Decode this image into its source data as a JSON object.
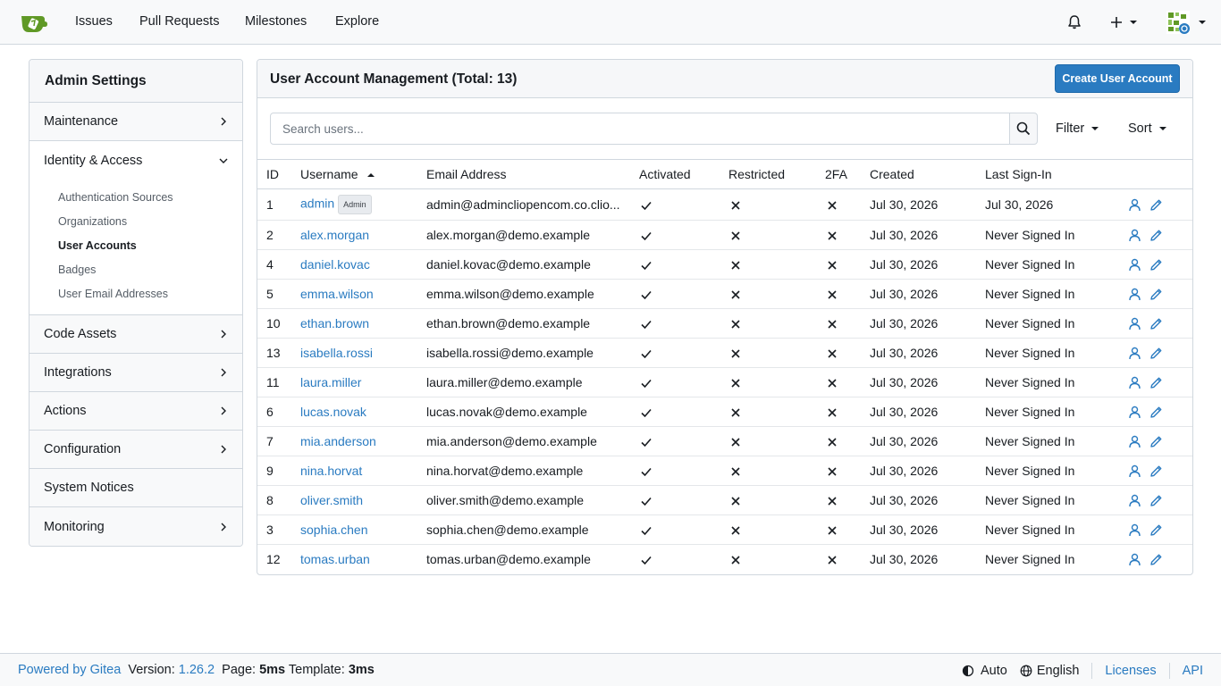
{
  "nav": {
    "links": [
      "Issues",
      "Pull Requests",
      "Milestones",
      "Explore"
    ],
    "icons": {
      "logo": "gitea-logo",
      "notifications": "bell-icon",
      "create": "plus-icon",
      "avatar": "user-avatar"
    }
  },
  "sidebar": {
    "title": "Admin Settings",
    "items": [
      {
        "label": "Maintenance",
        "chevron": "right"
      },
      {
        "label": "Identity & Access",
        "chevron": "down",
        "open": true,
        "children": [
          "Authentication Sources",
          "Organizations",
          "User Accounts",
          "Badges",
          "User Email Addresses"
        ],
        "active_child": "User Accounts"
      },
      {
        "label": "Code Assets",
        "chevron": "right"
      },
      {
        "label": "Integrations",
        "chevron": "right"
      },
      {
        "label": "Actions",
        "chevron": "right"
      },
      {
        "label": "Configuration",
        "chevron": "right"
      },
      {
        "label": "System Notices",
        "chevron": "none"
      },
      {
        "label": "Monitoring",
        "chevron": "right"
      }
    ]
  },
  "panel": {
    "title": "User Account Management (Total: 13)",
    "create_button": "Create User Account",
    "search_placeholder": "Search users...",
    "filter_label": "Filter",
    "sort_label": "Sort"
  },
  "table": {
    "headers": [
      "ID",
      "Username",
      "Email Address",
      "Activated",
      "Restricted",
      "2FA",
      "Created",
      "Last Sign-In"
    ],
    "sorted_column": "Username",
    "rows": [
      {
        "id": "1",
        "username": "admin",
        "badge": "Admin",
        "email": "admin@admincliopencom.co.clio...",
        "activated": true,
        "restricted": false,
        "twofa": false,
        "created": "Jul 30, 2026",
        "last": "Jul 30, 2026"
      },
      {
        "id": "2",
        "username": "alex.morgan",
        "badge": "",
        "email": "alex.morgan@demo.example",
        "activated": true,
        "restricted": false,
        "twofa": false,
        "created": "Jul 30, 2026",
        "last": "Never Signed In"
      },
      {
        "id": "4",
        "username": "daniel.kovac",
        "badge": "",
        "email": "daniel.kovac@demo.example",
        "activated": true,
        "restricted": false,
        "twofa": false,
        "created": "Jul 30, 2026",
        "last": "Never Signed In"
      },
      {
        "id": "5",
        "username": "emma.wilson",
        "badge": "",
        "email": "emma.wilson@demo.example",
        "activated": true,
        "restricted": false,
        "twofa": false,
        "created": "Jul 30, 2026",
        "last": "Never Signed In"
      },
      {
        "id": "10",
        "username": "ethan.brown",
        "badge": "",
        "email": "ethan.brown@demo.example",
        "activated": true,
        "restricted": false,
        "twofa": false,
        "created": "Jul 30, 2026",
        "last": "Never Signed In"
      },
      {
        "id": "13",
        "username": "isabella.rossi",
        "badge": "",
        "email": "isabella.rossi@demo.example",
        "activated": true,
        "restricted": false,
        "twofa": false,
        "created": "Jul 30, 2026",
        "last": "Never Signed In"
      },
      {
        "id": "11",
        "username": "laura.miller",
        "badge": "",
        "email": "laura.miller@demo.example",
        "activated": true,
        "restricted": false,
        "twofa": false,
        "created": "Jul 30, 2026",
        "last": "Never Signed In"
      },
      {
        "id": "6",
        "username": "lucas.novak",
        "badge": "",
        "email": "lucas.novak@demo.example",
        "activated": true,
        "restricted": false,
        "twofa": false,
        "created": "Jul 30, 2026",
        "last": "Never Signed In"
      },
      {
        "id": "7",
        "username": "mia.anderson",
        "badge": "",
        "email": "mia.anderson@demo.example",
        "activated": true,
        "restricted": false,
        "twofa": false,
        "created": "Jul 30, 2026",
        "last": "Never Signed In"
      },
      {
        "id": "9",
        "username": "nina.horvat",
        "badge": "",
        "email": "nina.horvat@demo.example",
        "activated": true,
        "restricted": false,
        "twofa": false,
        "created": "Jul 30, 2026",
        "last": "Never Signed In"
      },
      {
        "id": "8",
        "username": "oliver.smith",
        "badge": "",
        "email": "oliver.smith@demo.example",
        "activated": true,
        "restricted": false,
        "twofa": false,
        "created": "Jul 30, 2026",
        "last": "Never Signed In"
      },
      {
        "id": "3",
        "username": "sophia.chen",
        "badge": "",
        "email": "sophia.chen@demo.example",
        "activated": true,
        "restricted": false,
        "twofa": false,
        "created": "Jul 30, 2026",
        "last": "Never Signed In"
      },
      {
        "id": "12",
        "username": "tomas.urban",
        "badge": "",
        "email": "tomas.urban@demo.example",
        "activated": true,
        "restricted": false,
        "twofa": false,
        "created": "Jul 30, 2026",
        "last": "Never Signed In"
      }
    ]
  },
  "footer": {
    "powered_by": "Powered by Gitea",
    "version_label": "Version:",
    "version": "1.26.2",
    "page_label": "Page:",
    "page_time": "5ms",
    "template_label": "Template:",
    "template_time": "3ms",
    "theme": "Auto",
    "language": "English",
    "licenses": "Licenses",
    "api": "API"
  },
  "colors": {
    "accent": "#2a7bc1",
    "brand_green": "#609926"
  }
}
